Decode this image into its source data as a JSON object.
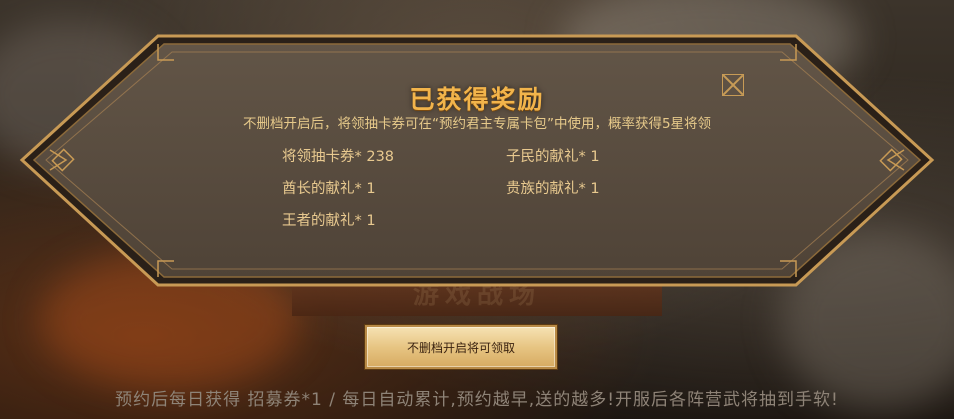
{
  "dialog": {
    "title": "已获得奖励",
    "subtitle": "不删档开启后，将领抽卡券可在“预约君主专属卡包”中使用，概率获得5星将领",
    "rewards": [
      "将领抽卡券* 238",
      "子民的献礼* 1",
      "酋长的献礼* 1",
      "贵族的献礼* 1",
      "王者的献礼* 1"
    ],
    "claim_button": "不删档开启将可领取"
  },
  "footer_text": "预约后每日获得 招募券*1 / 每日自动累计,预约越早,送的越多!开服后各阵营武将抽到手软!",
  "colors": {
    "accent_gold": "#f2b44b",
    "panel": "#5a4e41",
    "border": "#c89a55"
  }
}
